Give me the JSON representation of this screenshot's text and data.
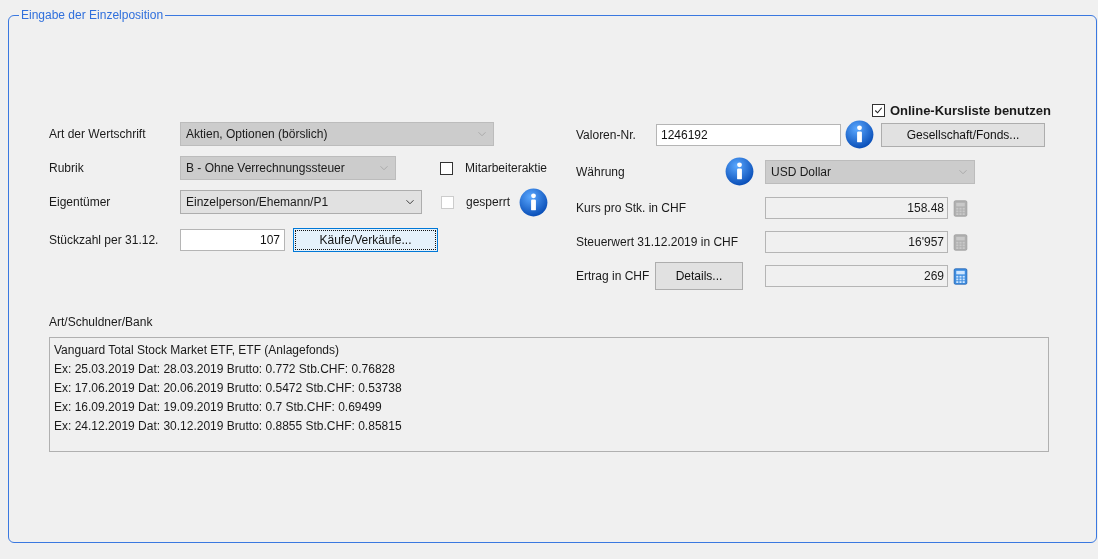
{
  "group_title": "Eingabe der Einzelposition",
  "online_price_list": {
    "label": "Online-Kursliste benutzen",
    "checked": true
  },
  "security_type": {
    "label": "Art der Wertschrift",
    "value": "Aktien, Optionen (börslich)",
    "disabled": true
  },
  "category": {
    "label": "Rubrik",
    "value": "B - Ohne Verrechnungssteuer",
    "disabled": true
  },
  "employee_share": {
    "label": "Mitarbeiteraktie",
    "checked": false,
    "disabled": false
  },
  "owner": {
    "label": "Eigentümer",
    "value": "Einzelperson/Ehemann/P1",
    "disabled": false
  },
  "blocked": {
    "label": "gesperrt",
    "checked": false,
    "disabled": true
  },
  "quantity": {
    "label": "Stückzahl per 31.12.",
    "value": "107"
  },
  "trades_button": "Käufe/Verkäufe...",
  "security_number": {
    "label": "Valoren-Nr.",
    "value": "1246192"
  },
  "company_button": "Gesellschaft/Fonds...",
  "currency": {
    "label": "Währung",
    "value": "USD Dollar",
    "disabled": true
  },
  "price": {
    "label": "Kurs pro Stk. in CHF",
    "value": "158.48",
    "calculator_enabled": false
  },
  "tax_value": {
    "label": "Steuerwert 31.12.2019 in CHF",
    "value": "16'957",
    "calculator_enabled": false
  },
  "income": {
    "label": "Ertrag in CHF",
    "button": "Details...",
    "value": "269",
    "calculator_enabled": true
  },
  "description": {
    "label": "Art/Schuldner/Bank",
    "lines": [
      "Vanguard Total Stock Market ETF, ETF (Anlagefonds)",
      "Ex: 25.03.2019 Dat: 28.03.2019 Brutto: 0.772 Stb.CHF: 0.76828",
      "Ex: 17.06.2019 Dat: 20.06.2019 Brutto: 0.5472 Stb.CHF: 0.53738",
      "Ex: 16.09.2019 Dat: 19.09.2019 Brutto: 0.7 Stb.CHF: 0.69499",
      "Ex: 24.12.2019 Dat: 30.12.2019 Brutto: 0.8855 Stb.CHF: 0.85815"
    ]
  }
}
